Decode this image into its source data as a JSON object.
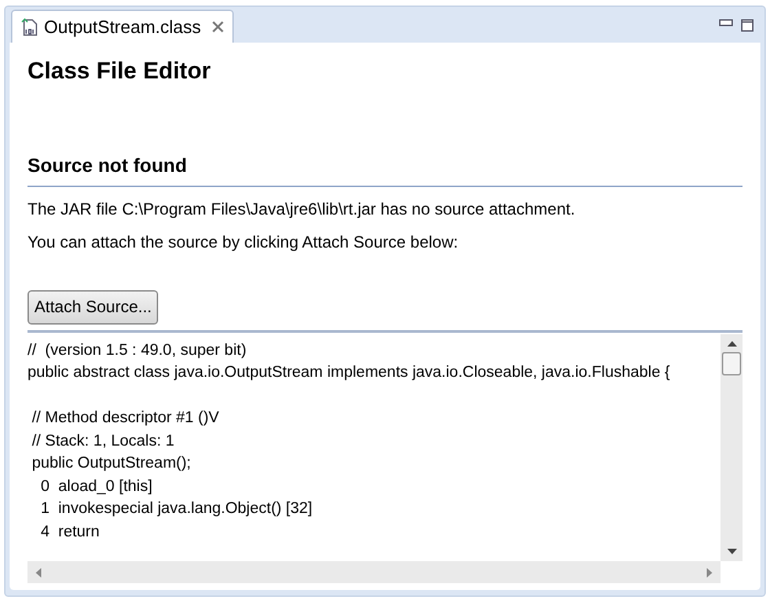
{
  "tabs": [
    {
      "label": "OutputStream.class",
      "selected": true
    }
  ],
  "editor": {
    "title": "Class File Editor",
    "section_title": "Source not found",
    "messages": [
      "The JAR file C:\\Program Files\\Java\\jre6\\lib\\rt.jar has no source attachment.",
      "You can attach the source by clicking Attach Source below:"
    ],
    "button": "Attach Source...",
    "code_blocks": [
      [
        "//  (version 1.5 : 49.0, super bit)",
        "public abstract class java.io.OutputStream implements java.io.Closeable, java.io.Flushable {"
      ],
      [
        " // Method descriptor #1 ()V",
        " // Stack: 1, Locals: 1",
        " public OutputStream();",
        "   0  aload_0 [this]",
        "   1  invokespecial java.lang.Object() [32]",
        "   4  return"
      ]
    ]
  }
}
